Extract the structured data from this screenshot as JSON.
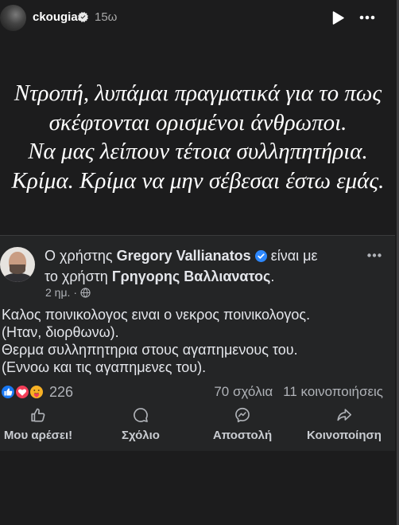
{
  "story": {
    "username": "ckougias",
    "time": "15ω",
    "caption_lines": [
      "Ντροπή, λυπάμαι πραγματικά για το πως",
      "σκέφτονται ορισμένοι άνθρωποι.",
      "Να μας λείπουν τέτοια συλληπητήρια.",
      "Κρίμα. Κρίμα να μην σέβεσαι έστω εμάς."
    ],
    "icons": {
      "verified": "verified-badge-icon",
      "play": "play-icon",
      "more": "more-options-icon"
    }
  },
  "post": {
    "header": {
      "prefix": "Ο χρήστης",
      "author": "Gregory Vallianatos",
      "with_1": "είναι με",
      "with_2": "το χρήστη",
      "tagged": "Γρηγορης Βαλλιανατος",
      "end": "."
    },
    "meta": {
      "time": "2 ημ.",
      "dot": "·",
      "audience_icon": "globe-icon"
    },
    "body_lines": [
      "Καλος ποινικολογος ειναι ο νεκρος ποινικολογος.",
      "(Ηταν, διορθωνω).",
      "Θερμα συλληπητηρια στους αγαπημενους του.",
      "(Εννοω και τις αγαπημενες του)."
    ],
    "stats": {
      "reaction_icons": [
        "like-reaction-icon",
        "love-reaction-icon",
        "care-reaction-icon"
      ],
      "reactions_count": "226",
      "comments": "70 σχόλια",
      "shares": "11 κοινοποιήσεις"
    },
    "actions": [
      {
        "label": "Μου αρέσει!",
        "icon": "like-icon"
      },
      {
        "label": "Σχόλιο",
        "icon": "comment-icon"
      },
      {
        "label": "Αποστολή",
        "icon": "send-icon"
      },
      {
        "label": "Κοινοποίηση",
        "icon": "share-icon"
      }
    ]
  },
  "colors": {
    "story_background": "#1c1c1d",
    "card_background": "#242526",
    "text_primary": "#e4e6eb",
    "text_secondary": "#b0b3b8",
    "verified_blue": "#2d88ff",
    "like_blue": "#1877f2",
    "love_red": "#f33e58"
  }
}
